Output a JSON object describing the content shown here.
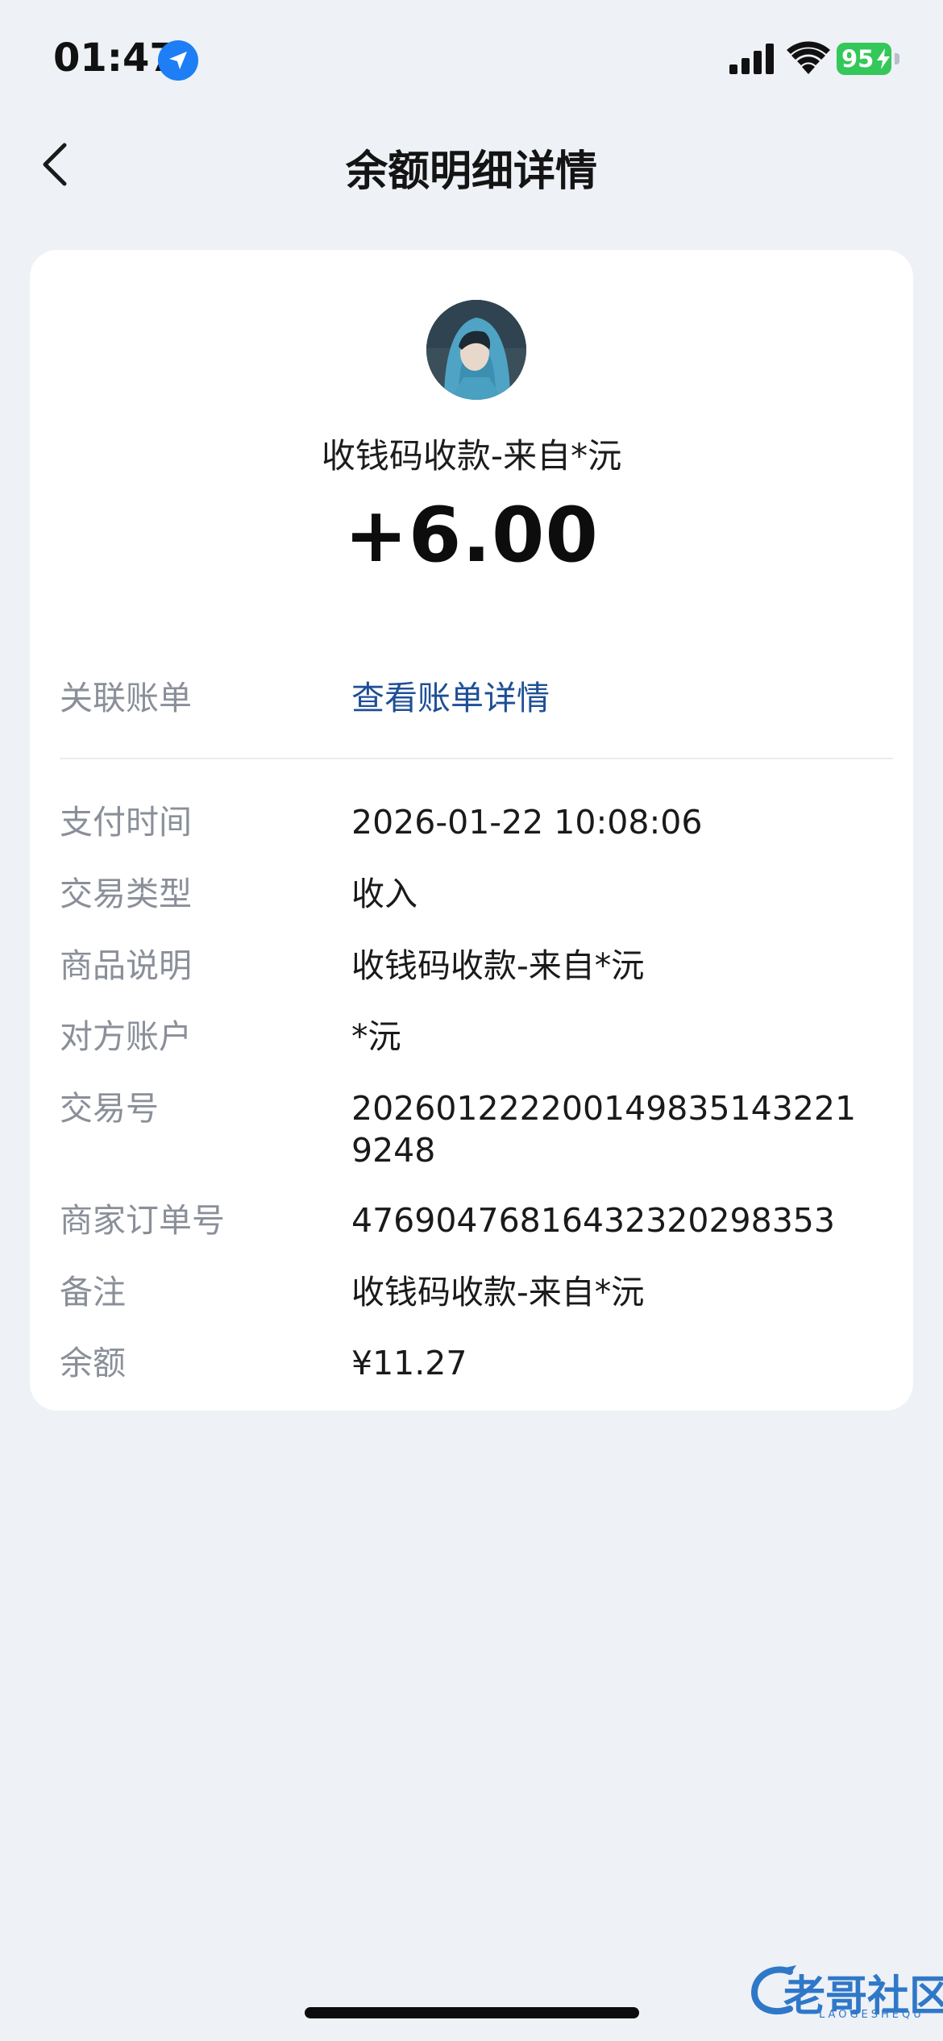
{
  "status_bar": {
    "time": "01:47",
    "battery": "95"
  },
  "nav": {
    "title": "余额明细详情"
  },
  "summary": {
    "merchant_title": "收钱码收款-来自*沅",
    "amount": "+6.00"
  },
  "linked_bill": {
    "label": "关联账单",
    "value": "查看账单详情"
  },
  "details": [
    {
      "label": "支付时间",
      "value": "2026-01-22 10:08:06"
    },
    {
      "label": "交易类型",
      "value": "收入"
    },
    {
      "label": "商品说明",
      "value": "收钱码收款-来自*沅"
    },
    {
      "label": "对方账户",
      "value": "*沅"
    },
    {
      "label": "交易号",
      "value": "2026012222001498351432219248"
    },
    {
      "label": "商家订单号",
      "value": "47690476816432320298353"
    },
    {
      "label": "备注",
      "value": "收钱码收款-来自*沅"
    },
    {
      "label": "余额",
      "value": "¥11.27"
    }
  ],
  "watermark": {
    "text": "老哥社区",
    "subtext": "LAOGESHEQU"
  },
  "colors": {
    "background": "#eef1f6",
    "card": "#ffffff",
    "link": "#1f4f96",
    "label": "#8a8f99",
    "battery": "#34c759",
    "location": "#1e7ef6"
  }
}
